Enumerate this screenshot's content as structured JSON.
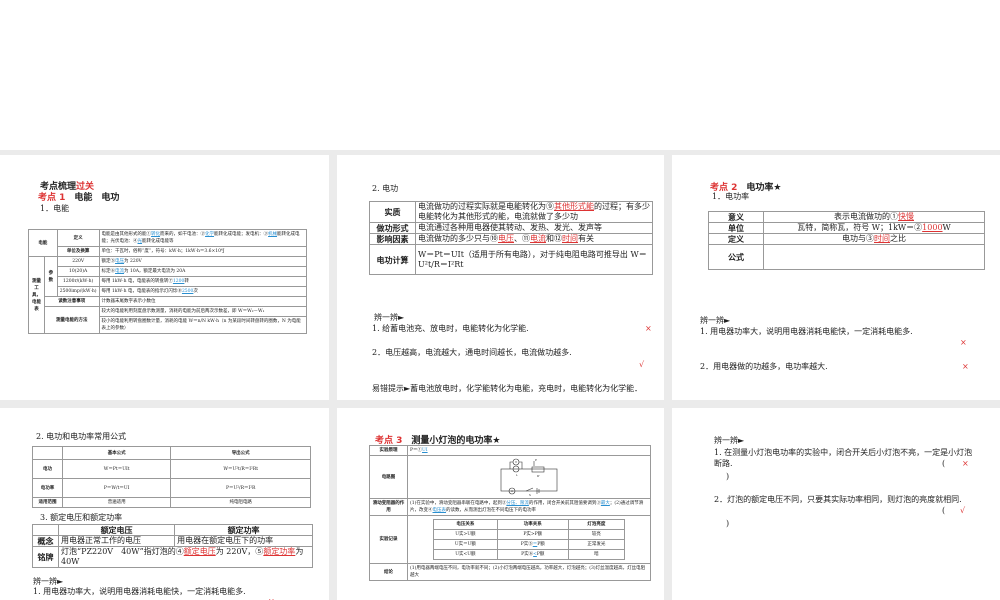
{
  "slide1": {
    "title_a": "考点梳理",
    "title_b": "过关",
    "kd": "考点 1",
    "kd_title": "电能　电功",
    "sub": "1．电能",
    "rows": [
      {
        "h": "电能",
        "k": "定义",
        "v": "电能是由其他形式的能①",
        "a1": "转化",
        "v2": "而来的，如干电池：②",
        "a2": "化学",
        "v3": "能转化成电能；发电机：③",
        "a3": "机械",
        "v4": "能转化成电能；光伏电池：④",
        "a4": "光",
        "v5": "能转化成电能等"
      },
      {
        "k": "单位及换算",
        "v": "单位：千瓦时，俗称“度”，符号：kW·h；1kW·h＝3.6×10⁶J"
      },
      {
        "h": "测量工具，电能表",
        "g": "参数",
        "k": "220V",
        "v": "额定⑤",
        "a": "电压",
        "v2": "为 220V"
      },
      {
        "k": "10(20)A",
        "v": "标定⑥",
        "a": "电流",
        "v2": "为 10A，额定最大电流为 20A"
      },
      {
        "k": "1200r/(kW·h)",
        "v": "每用 1kW·h 电，电能表的转盘转⑦",
        "a": "1200",
        "v2": "转"
      },
      {
        "k": "2500imp/(kW·h)",
        "v": "每用 1kW·h 电，电能表的指示灯闪烁⑧",
        "a": "2500",
        "v2": "次"
      },
      {
        "k": "读数注意事项",
        "v": "计数器末尾数字表示小数位"
      },
      {
        "k": "测量电能的方法",
        "v": "较大的电能利用刻度盘示数测量，消耗的电能为前后两次示数差，即 W＝W₂－W₁",
        "v2": "较小的电能利用转盘圈数计量，消耗的电能 W＝n/N kW·h（n 为某段时间转盘转的圈数，N 为电能表上的参数）"
      }
    ]
  },
  "slide2": {
    "sub": "2. 电功",
    "rows": [
      {
        "k": "实质",
        "v": "电流做功的过程实际就是电能转化为⑨",
        "a": "其他形式能",
        "v2": "的过程；有多少电能转化为其他形式的能，电流就做了多少功"
      },
      {
        "k": "做功形式",
        "v": "电流通过各种用电器使其转动、发热、发光、发声等"
      },
      {
        "k": "影响因素",
        "v": "电流做功的多少只与⑩",
        "a": "电压",
        "v2": "、⑪",
        "a2": "电流",
        "v3": "和⑫",
        "a3": "时间",
        "v4": "有关"
      },
      {
        "k": "电功计算",
        "v": "W＝Pt＝UIt（适用于所有电路），对于纯电阻电路可推导出 W＝U²t/R＝I²Rt"
      }
    ],
    "bian": "辨一辨►",
    "q1": "1. 给蓄电池充、放电时，电能转化为化学能.",
    "a1": "×",
    "q2": "2．电压越高，电流越大，通电时间越长，电流做功越多.",
    "a2": "√",
    "tip": "易错提示►蓄电池放电时，化学能转化为电能，充电时，电能转化为化学能．"
  },
  "slide3": {
    "kd": "考点 2",
    "kd_title": "电功率★",
    "sub": "1．电功率",
    "rows": [
      {
        "k": "意义",
        "v": "表示电流做功的①",
        "a": "快慢"
      },
      {
        "k": "单位",
        "v": "瓦特，简称瓦，符号 W；1kW＝②",
        "a": "1000",
        "v2": "W"
      },
      {
        "k": "定义",
        "v": "电功与③",
        "a": "时间",
        "v2": "之比"
      },
      {
        "k": "公式",
        "v": ""
      }
    ],
    "bian": "辨一辨►",
    "q1": "1. 用电器功率大，说明用电器消耗电能快，一定消耗电能多.",
    "a1": "×",
    "q2": "2．用电器做的功越多，电功率越大.",
    "a2": "×"
  },
  "slide4": {
    "sub": "2. 电功和电功率常用公式",
    "head": [
      "",
      "基本公式",
      "导出公式"
    ],
    "rows": [
      [
        "电功",
        "W＝Pt＝UIt",
        "W＝U²t/R＝I²Rt"
      ],
      [
        "电功率",
        "P＝W/t＝UI",
        "P＝U²/R＝I²R"
      ],
      [
        "适用范围",
        "普遍适用",
        "纯电阻电路"
      ]
    ],
    "sub2": "3. 额定电压和额定功率",
    "head2": [
      "",
      "额定电压",
      "额定功率"
    ],
    "r1": [
      "概念",
      "用电器正常工作的电压",
      "用电器在额定电压下的功率"
    ],
    "r2k": "铭牌",
    "r2v": "灯泡“PZ220V　40W”指灯泡的④",
    "r2a": "额定电压",
    "r2v2": "为 220V，⑤",
    "r2a2": "额定功率",
    "r2v3": "为 40W",
    "bian": "辨一辨►",
    "q1": "1. 用电器功率大，说明用电器消耗电能快，一定消耗电能多.",
    "a1": "×"
  },
  "slide5": {
    "kd": "考点 3",
    "kd_title": "测量小灯泡的电功率★",
    "r_principle": {
      "k": "实验原理",
      "v": "P＝①",
      "a": "UI"
    },
    "r_circuit": {
      "k": "电路图",
      "labels": [
        "V",
        "L",
        "A",
        "S",
        "P",
        "R'"
      ]
    },
    "r_rheo": {
      "k": "滑动变阻器的作用",
      "v": "(1)在实验中，滑动变阻器串联在电路中，起到②",
      "a": "分压、限流",
      "v2": "的作用，闭合开关前其阻值要调到③",
      "a2": "最大",
      "v3": "；(2)通过调节滑片，改变④",
      "a3": "电压表",
      "v4": "的读数，从而测出灯泡在不同电压下的电功率"
    },
    "r_record": {
      "k": "实验记录",
      "head": [
        "电压关系",
        "功率关系",
        "灯泡亮度"
      ],
      "rows": [
        [
          "U实>U额",
          "P实>P额",
          "",
          "较亮"
        ],
        [
          "U实＝U额",
          "P实⑤",
          "＝",
          "正常发光"
        ],
        [
          "U实<U额",
          "P实⑥",
          "<",
          "暗"
        ]
      ],
      "unit": "P额"
    },
    "r_concl": {
      "k": "结论",
      "v": "(1)用电器两端电压不同，电功率就不同；(2)小灯泡两端电压越高，功率越大，灯泡越亮；(3)灯丝温度越高，灯丝电阻越大"
    }
  },
  "slide6": {
    "bian": "辨一辨►",
    "q1": "1. 在测量小灯泡电功率的实验中，闭合开关后小灯泡不亮，一定是小灯泡断路.",
    "a1": "×",
    "q2": "2．灯泡的额定电压不同，只要其实际功率相同，则灯泡的亮度就相同.",
    "a2": "√",
    "paren_open": "(",
    "paren_close": ")"
  },
  "colors": {
    "accent_red": "#d33333",
    "answer_blue": "#2a8fd0",
    "gap": "#ebebeb"
  }
}
